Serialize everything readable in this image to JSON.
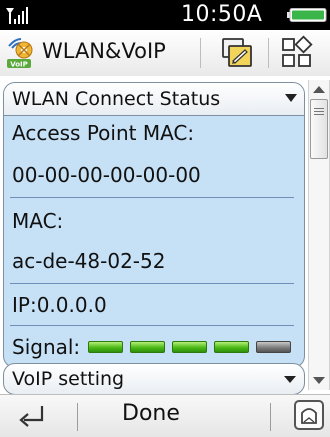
{
  "status_bar": {
    "time": "10:50A",
    "icons": {
      "signal": "signal-strength-icon",
      "battery": "battery-icon"
    }
  },
  "title_bar": {
    "title": "WLAN&VoIP",
    "icons": {
      "app": "wlan-voip-icon",
      "edit": "edit-icon",
      "view": "grid-view-icon"
    }
  },
  "wlan_section": {
    "header": "WLAN Connect Status",
    "ap_mac_label": "Access Point MAC:",
    "ap_mac_value": "00-00-00-00-00-00",
    "mac_label": "MAC:",
    "mac_value": "ac-de-48-02-52",
    "ip": "IP:0.0.0.0",
    "signal_label": "Signal:",
    "signal_level": 4,
    "signal_max": 5
  },
  "voip_section": {
    "header": "VoIP setting"
  },
  "bottom_bar": {
    "done_label": "Done",
    "icons": {
      "back": "back-icon",
      "home": "home-icon"
    }
  },
  "colors": {
    "panel_bg": "#c6e0f6",
    "signal_on": "#4cbb17",
    "signal_off": "#7d7d7d"
  }
}
